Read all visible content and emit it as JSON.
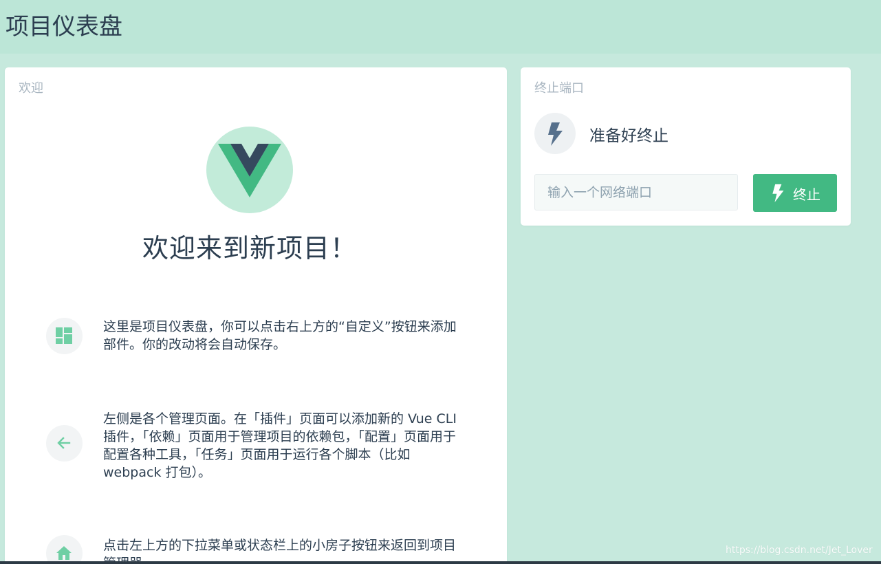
{
  "header": {
    "title": "项目仪表盘"
  },
  "welcome_card": {
    "title": "欢迎",
    "heading": "欢迎来到新项目！",
    "tips": [
      {
        "icon": "dashboard-icon",
        "text": "这里是项目仪表盘，你可以点击右上方的“自定义”按钮来添加部件。你的改动将会自动保存。"
      },
      {
        "icon": "arrow-left-icon",
        "text": "左侧是各个管理页面。在「插件」页面可以添加新的 Vue CLI 插件，「依赖」页面用于管理项目的依赖包，「配置」页面用于配置各种工具，「任务」页面用于运行各个脚本（比如 webpack 打包）。"
      },
      {
        "icon": "home-icon",
        "text": "点击左上方的下拉菜单或状态栏上的小房子按钮来返回到项目管理器。"
      }
    ]
  },
  "kill_port_card": {
    "title": "终止端口",
    "status": "准备好终止",
    "input_placeholder": "输入一个网络端口",
    "input_value": "",
    "button_label": "终止"
  },
  "watermark": "https://blog.csdn.net/Jet_Lover",
  "colors": {
    "background": "#c6e9dd",
    "topbar": "#bce6d7",
    "accent": "#42b983",
    "vue_dark": "#35495e",
    "text": "#2c3e50"
  }
}
